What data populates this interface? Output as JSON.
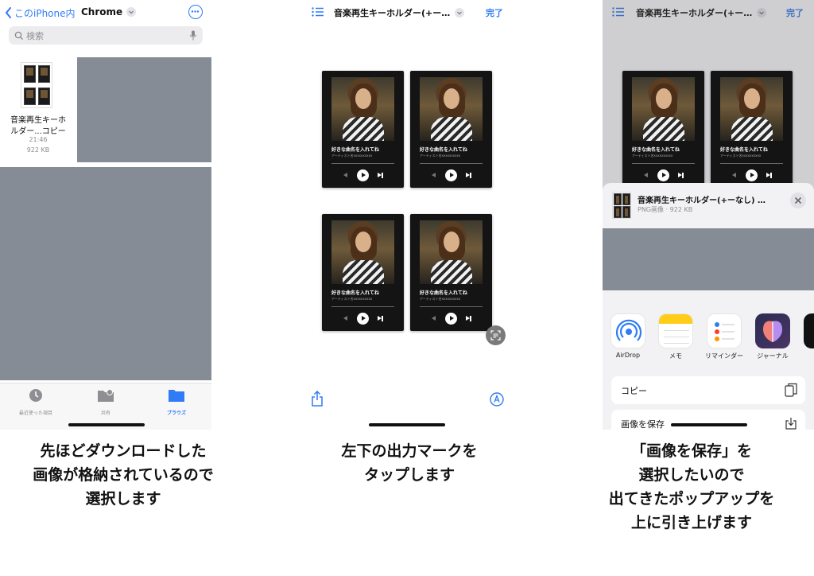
{
  "panel1": {
    "back_label": "このiPhone内",
    "folder_title": "Chrome",
    "search_placeholder": "検索",
    "file": {
      "name_line1": "音楽再生キーホ",
      "name_line2": "ルダー...コピー",
      "time": "21:46",
      "size": "922 KB"
    },
    "tabs": [
      {
        "label": "最近使った項目"
      },
      {
        "label": "共有"
      },
      {
        "label": "ブラウズ"
      }
    ]
  },
  "panel2": {
    "title": "音楽再生キーホルダー(+ー…",
    "done_label": "完了",
    "card": {
      "song": "好きな曲名を入れてね",
      "artist": "アーティスト名xxxxxxxxxx"
    }
  },
  "panel3": {
    "title": "音楽再生キーホルダー(+ー…",
    "done_label": "完了",
    "share_title": "音楽再生キーホルダー(+ーなし) …",
    "share_subtitle": "PNG画像 · 922 KB",
    "apps": [
      {
        "label": "AirDrop"
      },
      {
        "label": "メモ"
      },
      {
        "label": "リマインダー"
      },
      {
        "label": "ジャーナル"
      }
    ],
    "actions": [
      {
        "label": "コピー"
      },
      {
        "label": "画像を保存"
      }
    ]
  },
  "captions": {
    "c1": [
      "先ほどダウンロードした",
      "画像が格納されているので",
      "選択します"
    ],
    "c2": [
      "左下の出力マークを",
      "タップします"
    ],
    "c3": [
      "「画像を保存」を",
      "選択したいので",
      "出てきたポップアップを",
      "上に引き上げます"
    ]
  },
  "colors": {
    "accent": "#2f7cf6",
    "placeholder_block": "#858c96",
    "card_bg": "#141414"
  }
}
